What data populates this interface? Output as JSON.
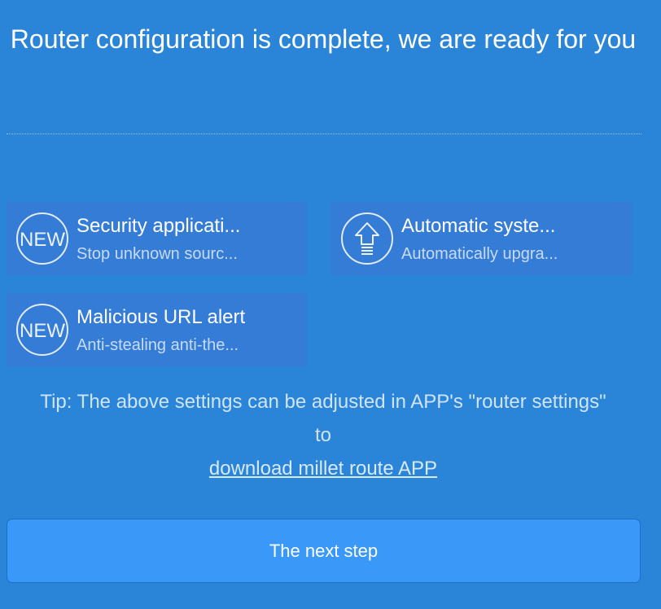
{
  "header": {
    "title": "Router configuration is complete, we are ready for you"
  },
  "features": [
    {
      "icon": "new-badge-icon",
      "icon_text": "NEW",
      "title": "Security applicati...",
      "description": "Stop unknown sourc..."
    },
    {
      "icon": "upgrade-arrow-icon",
      "title": "Automatic syste...",
      "description": "Automatically upgra..."
    },
    {
      "icon": "new-badge-icon",
      "icon_text": "NEW",
      "title": "Malicious URL alert",
      "description": "Anti-stealing anti-the..."
    }
  ],
  "tip": {
    "text": "Tip: The above settings can be adjusted in APP's \"router settings\" to",
    "link_label": "download millet route APP"
  },
  "footer": {
    "next_label": "The next step"
  },
  "colors": {
    "background": "#2a85d9",
    "button": "#3a98f8",
    "text": "#ffffff"
  }
}
